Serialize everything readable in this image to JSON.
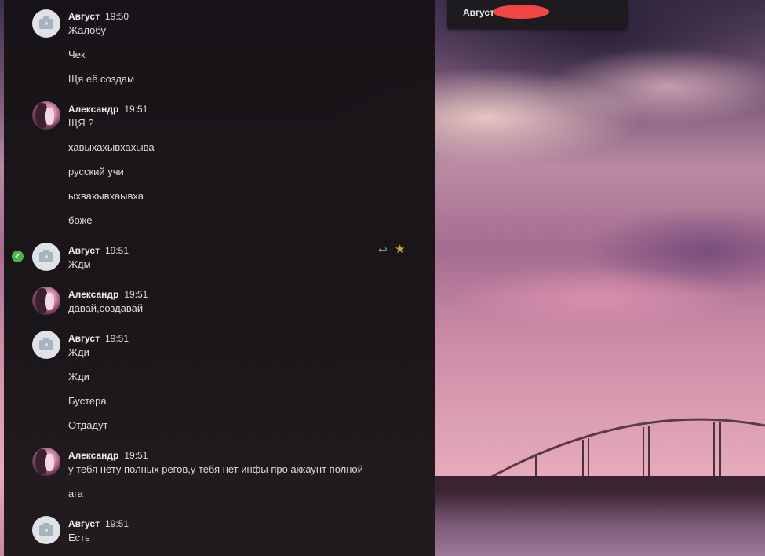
{
  "header": {
    "contact_name": "Август"
  },
  "colors": {
    "panel": "#161216",
    "accent_check": "#4bb34b",
    "star": "#c9a341",
    "redaction": "#ef4545"
  },
  "messages": [
    {
      "author": "Август",
      "time": "19:50",
      "avatar": "camera-icon",
      "lines": [
        "Жалобу",
        "Чек",
        "Щя её создам"
      ]
    },
    {
      "author": "Александр",
      "time": "19:51",
      "avatar": "user-photo",
      "lines": [
        "ЩЯ ?",
        "хавыхахывхахыва",
        "русский учи",
        "ыхвахывхаывха",
        "боже"
      ]
    },
    {
      "author": "Август",
      "time": "19:51",
      "avatar": "camera-icon",
      "lines": [
        "Ждм"
      ],
      "selected": true
    },
    {
      "author": "Александр",
      "time": "19:51",
      "avatar": "user-photo",
      "lines": [
        "давай,создавай"
      ]
    },
    {
      "author": "Август",
      "time": "19:51",
      "avatar": "camera-icon",
      "lines": [
        "Жди",
        "Жди",
        "Бустера",
        "Отдадут"
      ]
    },
    {
      "author": "Александр",
      "time": "19:51",
      "avatar": "user-photo",
      "lines": [
        "у тебя нету полных регов,у тебя нет инфы про аккаунт полной",
        "ага"
      ]
    },
    {
      "author": "Август",
      "time": "19:51",
      "avatar": "camera-icon",
      "lines": [
        "Есть"
      ]
    }
  ],
  "icons": {
    "reply": "reply-icon",
    "favorite": "star-icon",
    "selected": "check-icon"
  }
}
